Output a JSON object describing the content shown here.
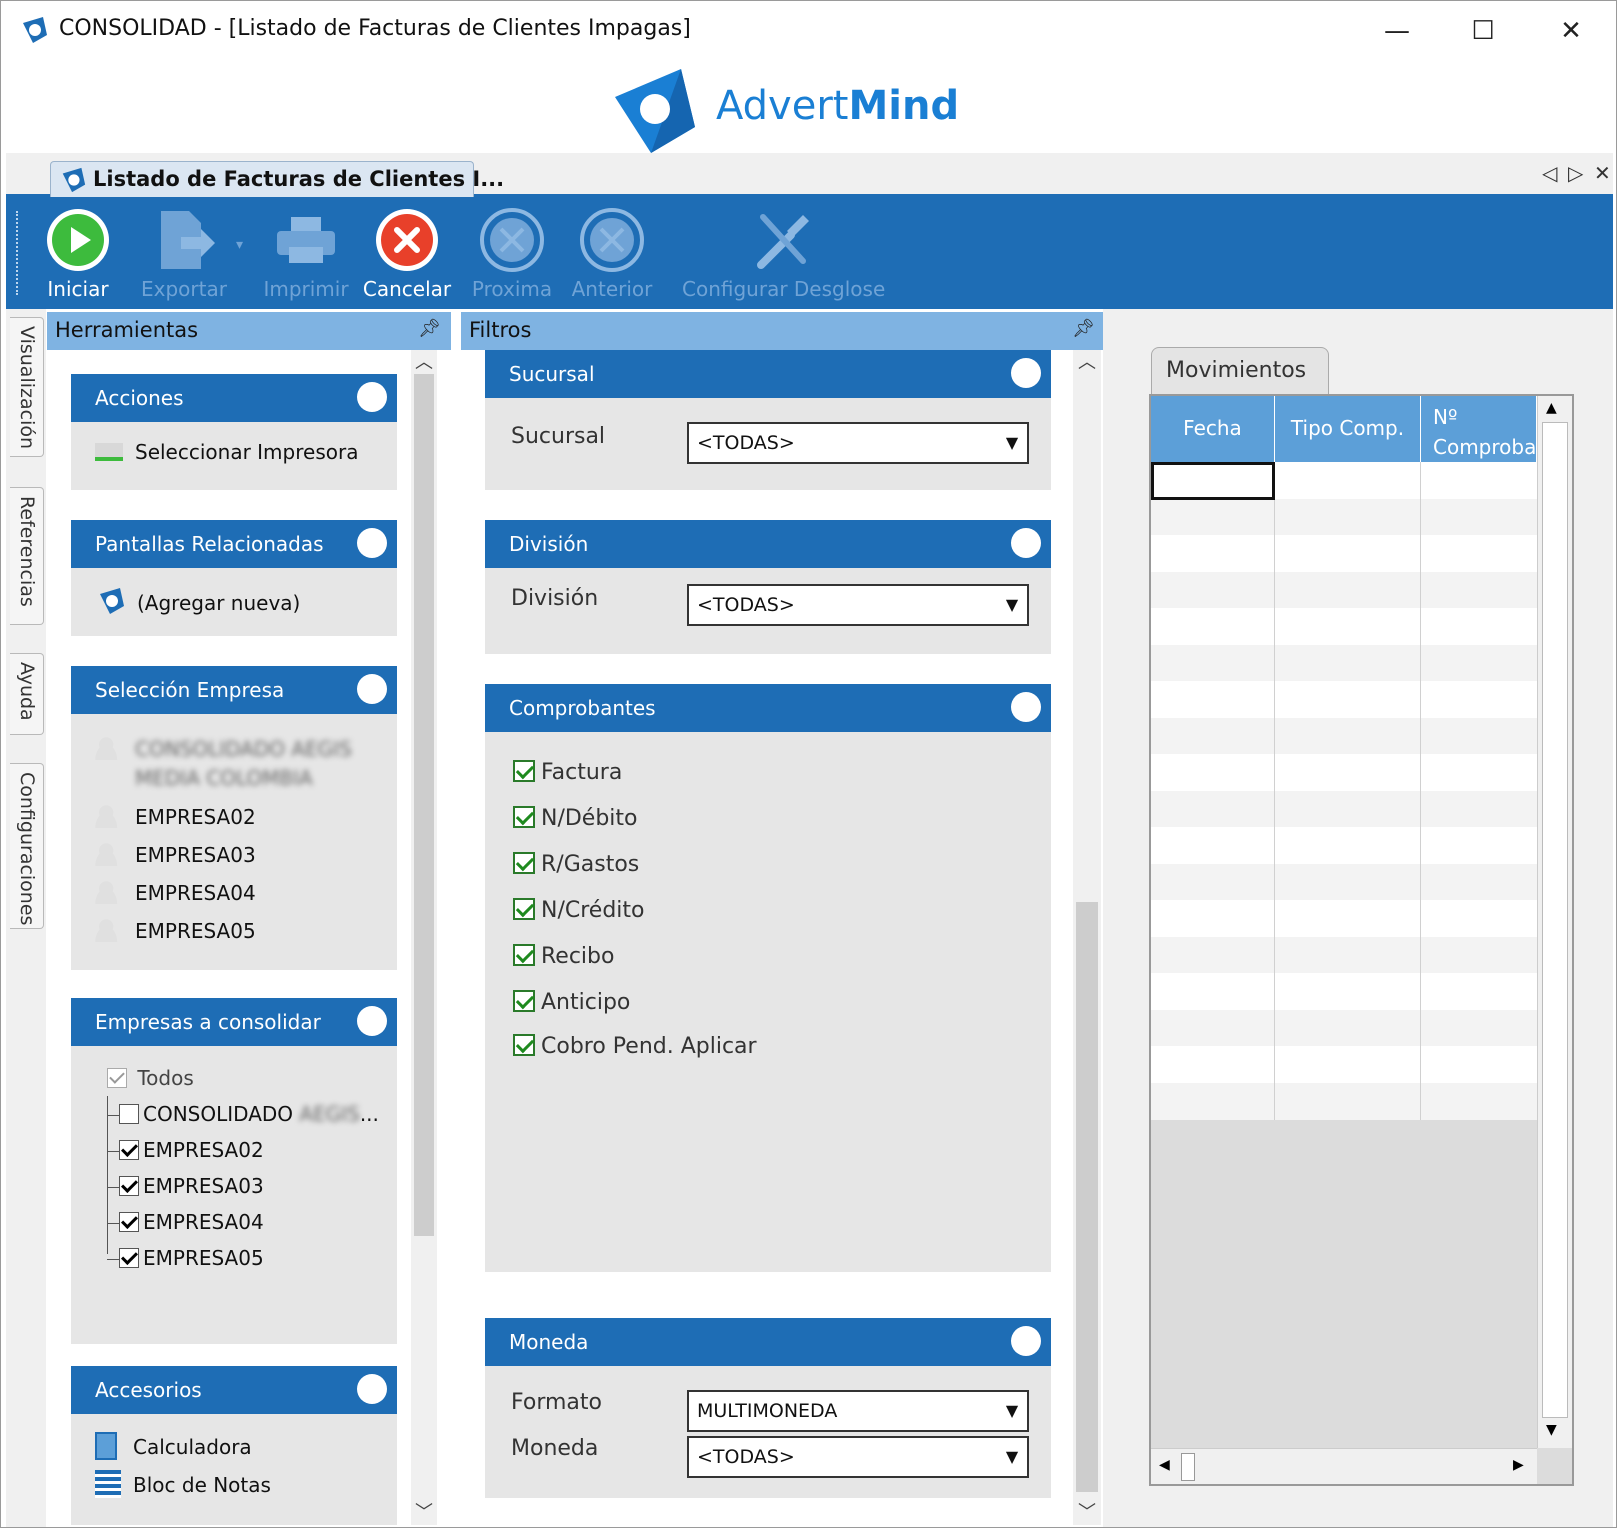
{
  "window": {
    "title": "CONSOLIDAD - [Listado de Facturas de Clientes Impagas]",
    "minimize": "—",
    "maximize": "☐",
    "close": "✕"
  },
  "logo": {
    "text_light": "Advert",
    "text_bold": "Mind",
    "color": "#1a7fd4"
  },
  "doc_tab": {
    "label": "Listado de Facturas de Clientes I..."
  },
  "toolbar": {
    "iniciar": "Iniciar",
    "exportar": "Exportar",
    "imprimir": "Imprimir",
    "cancelar": "Cancelar",
    "proxima": "Proxima",
    "anterior": "Anterior",
    "configurar": "Configurar Desglose"
  },
  "side_tabs": [
    "Visualización",
    "Referencias",
    "Ayuda",
    "Configuraciones"
  ],
  "herramientas": {
    "title": "Herramientas",
    "acciones": {
      "title": "Acciones",
      "items": [
        "Seleccionar Impresora"
      ]
    },
    "pantallas": {
      "title": "Pantallas Relacionadas",
      "items": [
        "(Agregar nueva)"
      ]
    },
    "seleccion": {
      "title": "Selección Empresa",
      "blurred_line1": "CONSOLIDADO AEGIS",
      "blurred_line2": "MEDIA COLOMBIA",
      "items": [
        "EMPRESA02",
        "EMPRESA03",
        "EMPRESA04",
        "EMPRESA05"
      ]
    },
    "consolidar": {
      "title": "Empresas a consolidar",
      "todos": "Todos",
      "consolidado": "CONSOLIDADO",
      "consolidado_blur": "AEGIS",
      "ellipsis": "...",
      "items": [
        "EMPRESA02",
        "EMPRESA03",
        "EMPRESA04",
        "EMPRESA05"
      ]
    },
    "accesorios": {
      "title": "Accesorios",
      "items": [
        "Calculadora",
        "Bloc de Notas"
      ]
    }
  },
  "filtros": {
    "title": "Filtros",
    "sucursal": {
      "title": "Sucursal",
      "label": "Sucursal",
      "value": "<TODAS>"
    },
    "division": {
      "title": "División",
      "label": "División",
      "value": "<TODAS>"
    },
    "comprobantes": {
      "title": "Comprobantes",
      "items": [
        "Factura",
        "N/Débito",
        "R/Gastos",
        "N/Crédito",
        "Recibo",
        "Anticipo",
        "Cobro Pend. Aplicar"
      ]
    },
    "moneda": {
      "title": "Moneda",
      "formato_label": "Formato",
      "formato_value": "MULTIMONEDA",
      "moneda_label": "Moneda",
      "moneda_value": "<TODAS>"
    }
  },
  "movimientos": {
    "tab": "Movimientos",
    "columns": [
      "Fecha",
      "Tipo Comp.",
      "Nº\nComproba"
    ]
  }
}
